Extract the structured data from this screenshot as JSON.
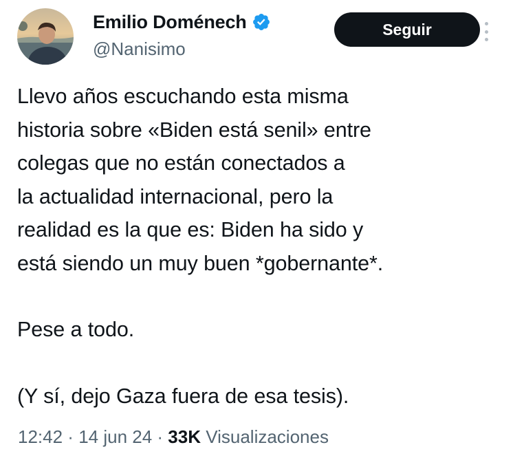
{
  "author": {
    "display_name": "Emilio Doménech",
    "handle": "@Nanisimo",
    "verified": true
  },
  "follow_button": {
    "label": "Seguir"
  },
  "tweet": {
    "paragraphs": [
      "Llevo años escuchando esta misma\nhistoria sobre «Biden está senil» entre\ncolegas que no están conectados a\nla actualidad internacional, pero la\nrealidad es la que es: Biden ha sido y\nestá siendo un muy buen *gobernante*.",
      "Pese a todo.",
      "(Y sí, dejo Gaza fuera de esa tesis)."
    ]
  },
  "meta": {
    "time": "12:42",
    "separator": " · ",
    "date": "14 jun 24",
    "views_count": "33K",
    "views_label": "Visualizaciones"
  },
  "colors": {
    "verified_badge": "#1d9bf0",
    "follow_button_bg": "#0f1419",
    "secondary_text": "#536471",
    "primary_text": "#0f1419"
  },
  "icons": {
    "verified": "verified-badge-icon",
    "more": "more-options-icon"
  }
}
